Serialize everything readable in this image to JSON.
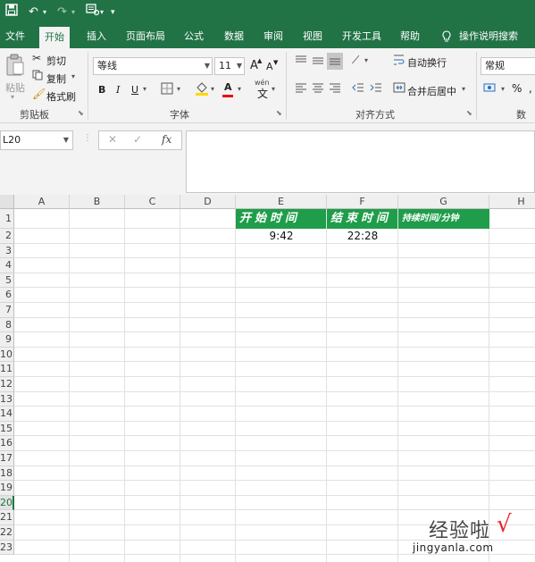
{
  "quick_access": {
    "save_icon": "save-icon",
    "undo_icon": "undo-icon",
    "redo_icon": "redo-icon",
    "print_preview_icon": "print-preview-icon",
    "customize_icon": "customize-dropdown-icon"
  },
  "tabs": [
    "文件",
    "开始",
    "插入",
    "页面布局",
    "公式",
    "数据",
    "审阅",
    "视图",
    "开发工具",
    "帮助"
  ],
  "active_tab": "开始",
  "tell_me": "操作说明搜索",
  "ribbon": {
    "clipboard": {
      "paste": "粘贴",
      "cut": "剪切",
      "copy": "复制",
      "format_painter": "格式刷",
      "group_label": "剪贴板"
    },
    "font": {
      "font_name": "等线",
      "font_size": "11",
      "grow": "A",
      "shrink": "A",
      "bold": "B",
      "italic": "I",
      "underline": "U",
      "font_color_letter": "A",
      "phonetic": "wén",
      "group_label": "字体"
    },
    "alignment": {
      "wrap_text": "自动换行",
      "merge_center": "合并后居中",
      "group_label": "对齐方式"
    },
    "number": {
      "format": "常规",
      "percent": "%",
      "group_label": "数字"
    }
  },
  "formula_bar": {
    "name_box": "L20",
    "cancel": "✕",
    "enter": "✓",
    "fx": "fx",
    "content": ""
  },
  "columns": [
    "A",
    "B",
    "C",
    "D",
    "E",
    "F",
    "G",
    "H"
  ],
  "rows": [
    "1",
    "2",
    "3",
    "4",
    "5",
    "6",
    "7",
    "8",
    "9",
    "10",
    "11",
    "12",
    "13",
    "14",
    "15",
    "16",
    "17",
    "18",
    "19",
    "20",
    "21",
    "22",
    "23"
  ],
  "cells": {
    "E1": "开始时间",
    "F1": "结束时间",
    "G1": "持续时间/分钟",
    "E2": "9:42",
    "F2": "22:28"
  },
  "selected_row": "20",
  "colors": {
    "excel_green": "#217346",
    "header_fill": "#1f9d4a",
    "watermark_check": "#e22222"
  },
  "watermark": {
    "brand": "经验啦",
    "check": "√",
    "url": "jingyanla.com"
  }
}
